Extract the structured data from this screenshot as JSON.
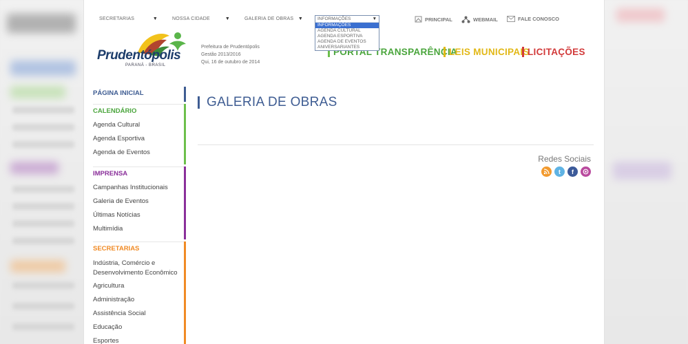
{
  "topnav": {
    "selects": [
      {
        "label": "SECRETARIAS"
      },
      {
        "label": "NOSSA CIDADE"
      },
      {
        "label": "GALERIA DE OBRAS"
      }
    ],
    "info_dropdown": {
      "selected": "INFORMAÇÕES",
      "options": [
        "INFORMAÇÕES",
        "AGENDA CULTURAL",
        "AGENDA ESPORTIVA",
        "AGENDA DE EVENTOS",
        "ANIVERSARIANTES"
      ]
    },
    "links": {
      "principal": "PRINCIPAL",
      "webmail": "WEBMAIL",
      "fale": "FALE CONOSCO"
    }
  },
  "header": {
    "logo_text": "Prudentópolis",
    "logo_sub": "PARANÁ - BRASIL",
    "prefeitura": "Prefeitura de Prudentópolis",
    "gestao": "Gestão 2013/2016",
    "date": "Qui, 16 de outubro de 2014",
    "portal": "PORTAL TRANSPARÊNCIA",
    "leis": "LEIS MUNICIPAIS",
    "licitacoes": "LICITAÇÕES"
  },
  "sidebar": {
    "home": "PÁGINA INICIAL",
    "calendario": {
      "title": "CALENDÁRIO",
      "items": [
        "Agenda Cultural",
        "Agenda Esportiva",
        "Agenda de Eventos"
      ]
    },
    "imprensa": {
      "title": "IMPRENSA",
      "items": [
        "Campanhas Institucionais",
        "Galeria de Eventos",
        "Últimas Notícias",
        "Multimídia"
      ]
    },
    "secretarias": {
      "title": "SECRETARIAS",
      "items": [
        "Indústria, Comércio e Desenvolvimento Econômico",
        "Agricultura",
        "Administração",
        "Assistência Social",
        "Educação",
        "Esportes"
      ]
    }
  },
  "main": {
    "title": "GALERIA DE OBRAS",
    "redes_label": "Redes Sociais"
  },
  "colors": {
    "blue": "#3e5c92",
    "green": "#6cbf4b",
    "purple": "#8a2f9a",
    "orange": "#f08a24",
    "yellow": "#e2b817",
    "red": "#d23a3a"
  },
  "icons": [
    "principal-icon",
    "webmail-icon",
    "envelope-icon",
    "rss-icon",
    "twitter-icon",
    "facebook-icon",
    "instagram-icon"
  ]
}
